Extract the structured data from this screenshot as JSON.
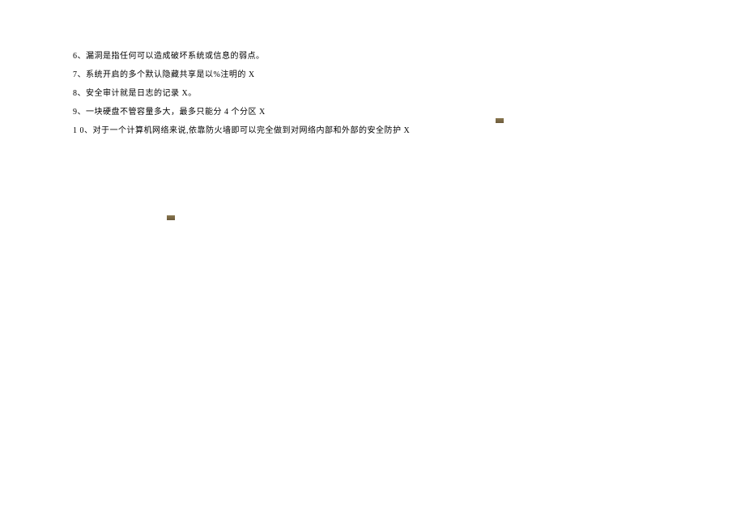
{
  "lines": [
    "6、漏洞是指任何可以造成破坏系统或信息的弱点。",
    "7、系统开启的多个默认隐藏共享是以%注明的 X",
    "8、安全审计就是日志的记录 X。",
    "9、一块硬盘不管容量多大，最多只能分 4 个分区 X",
    "1 0、对于一个计算机网络来说,依靠防火墙即可以完全做到对网络内部和外部的安全防护 X"
  ]
}
